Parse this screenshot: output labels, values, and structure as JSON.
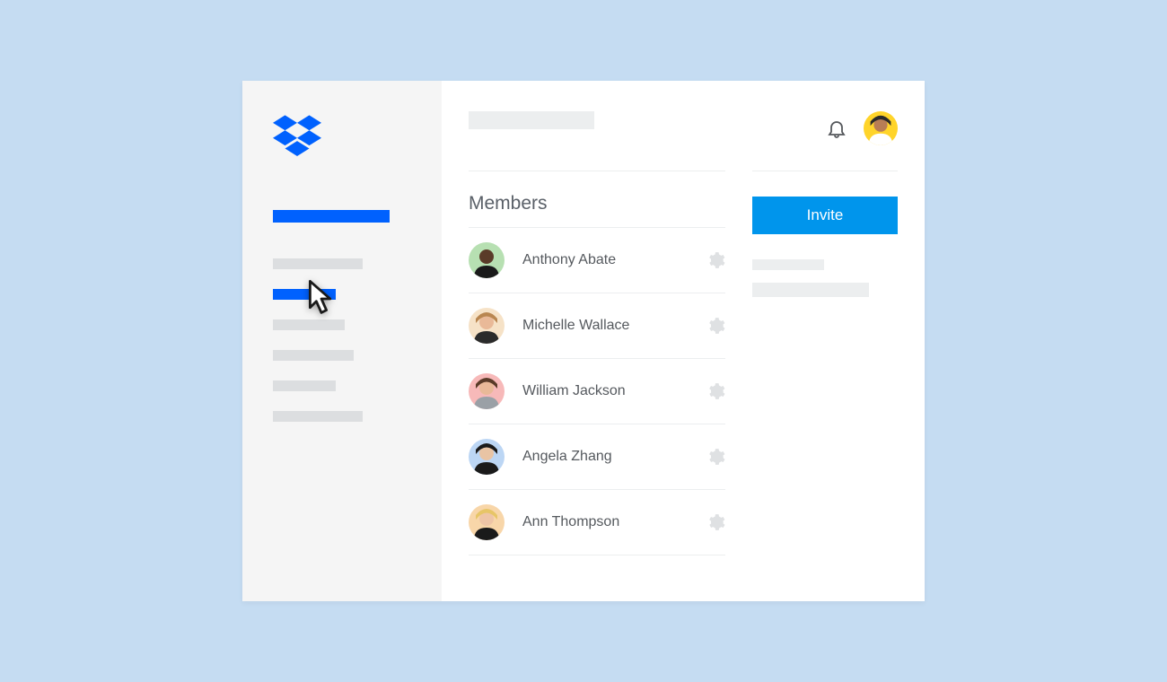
{
  "brand": {
    "name": "Dropbox",
    "color": "#0061fe"
  },
  "sidebar": {
    "primary_active": true,
    "items": [
      {
        "active": false
      },
      {
        "active": true
      },
      {
        "active": false
      },
      {
        "active": false
      },
      {
        "active": false
      },
      {
        "active": false
      }
    ]
  },
  "header": {
    "title_placeholder": ""
  },
  "section": {
    "title": "Members"
  },
  "members": [
    {
      "name": "Anthony Abate",
      "avatar_bg": "#b7e0b2",
      "skin": "#5a3b28",
      "shirt": "#1a1a1a"
    },
    {
      "name": "Michelle Wallace",
      "avatar_bg": "#f6e2c7",
      "skin": "#e9b998",
      "shirt": "#2b2b2b",
      "hair": "#b98650"
    },
    {
      "name": "William Jackson",
      "avatar_bg": "#f7b9b9",
      "skin": "#e9b998",
      "shirt": "#9aa0a6",
      "hair": "#5a3b28"
    },
    {
      "name": "Angela Zhang",
      "avatar_bg": "#bcd6f4",
      "skin": "#e9c4a4",
      "shirt": "#1a1a1a",
      "hair": "#1a1a1a"
    },
    {
      "name": "Ann Thompson",
      "avatar_bg": "#f8d6a9",
      "skin": "#eec5a6",
      "shirt": "#1a1a1a",
      "hair": "#e7c567"
    }
  ],
  "actions": {
    "invite_label": "Invite"
  },
  "current_user": {
    "avatar_bg": "#ffd42a",
    "skin": "#b87d56",
    "shirt": "#ffffff",
    "hair": "#2a2a2a"
  },
  "icons": {
    "gear": "gear-icon",
    "bell": "bell-icon",
    "cursor": "cursor-icon",
    "logo": "dropbox-logo"
  },
  "colors": {
    "accent": "#0061fe",
    "invite": "#0095ec",
    "page_bg": "#c5dcf2"
  }
}
